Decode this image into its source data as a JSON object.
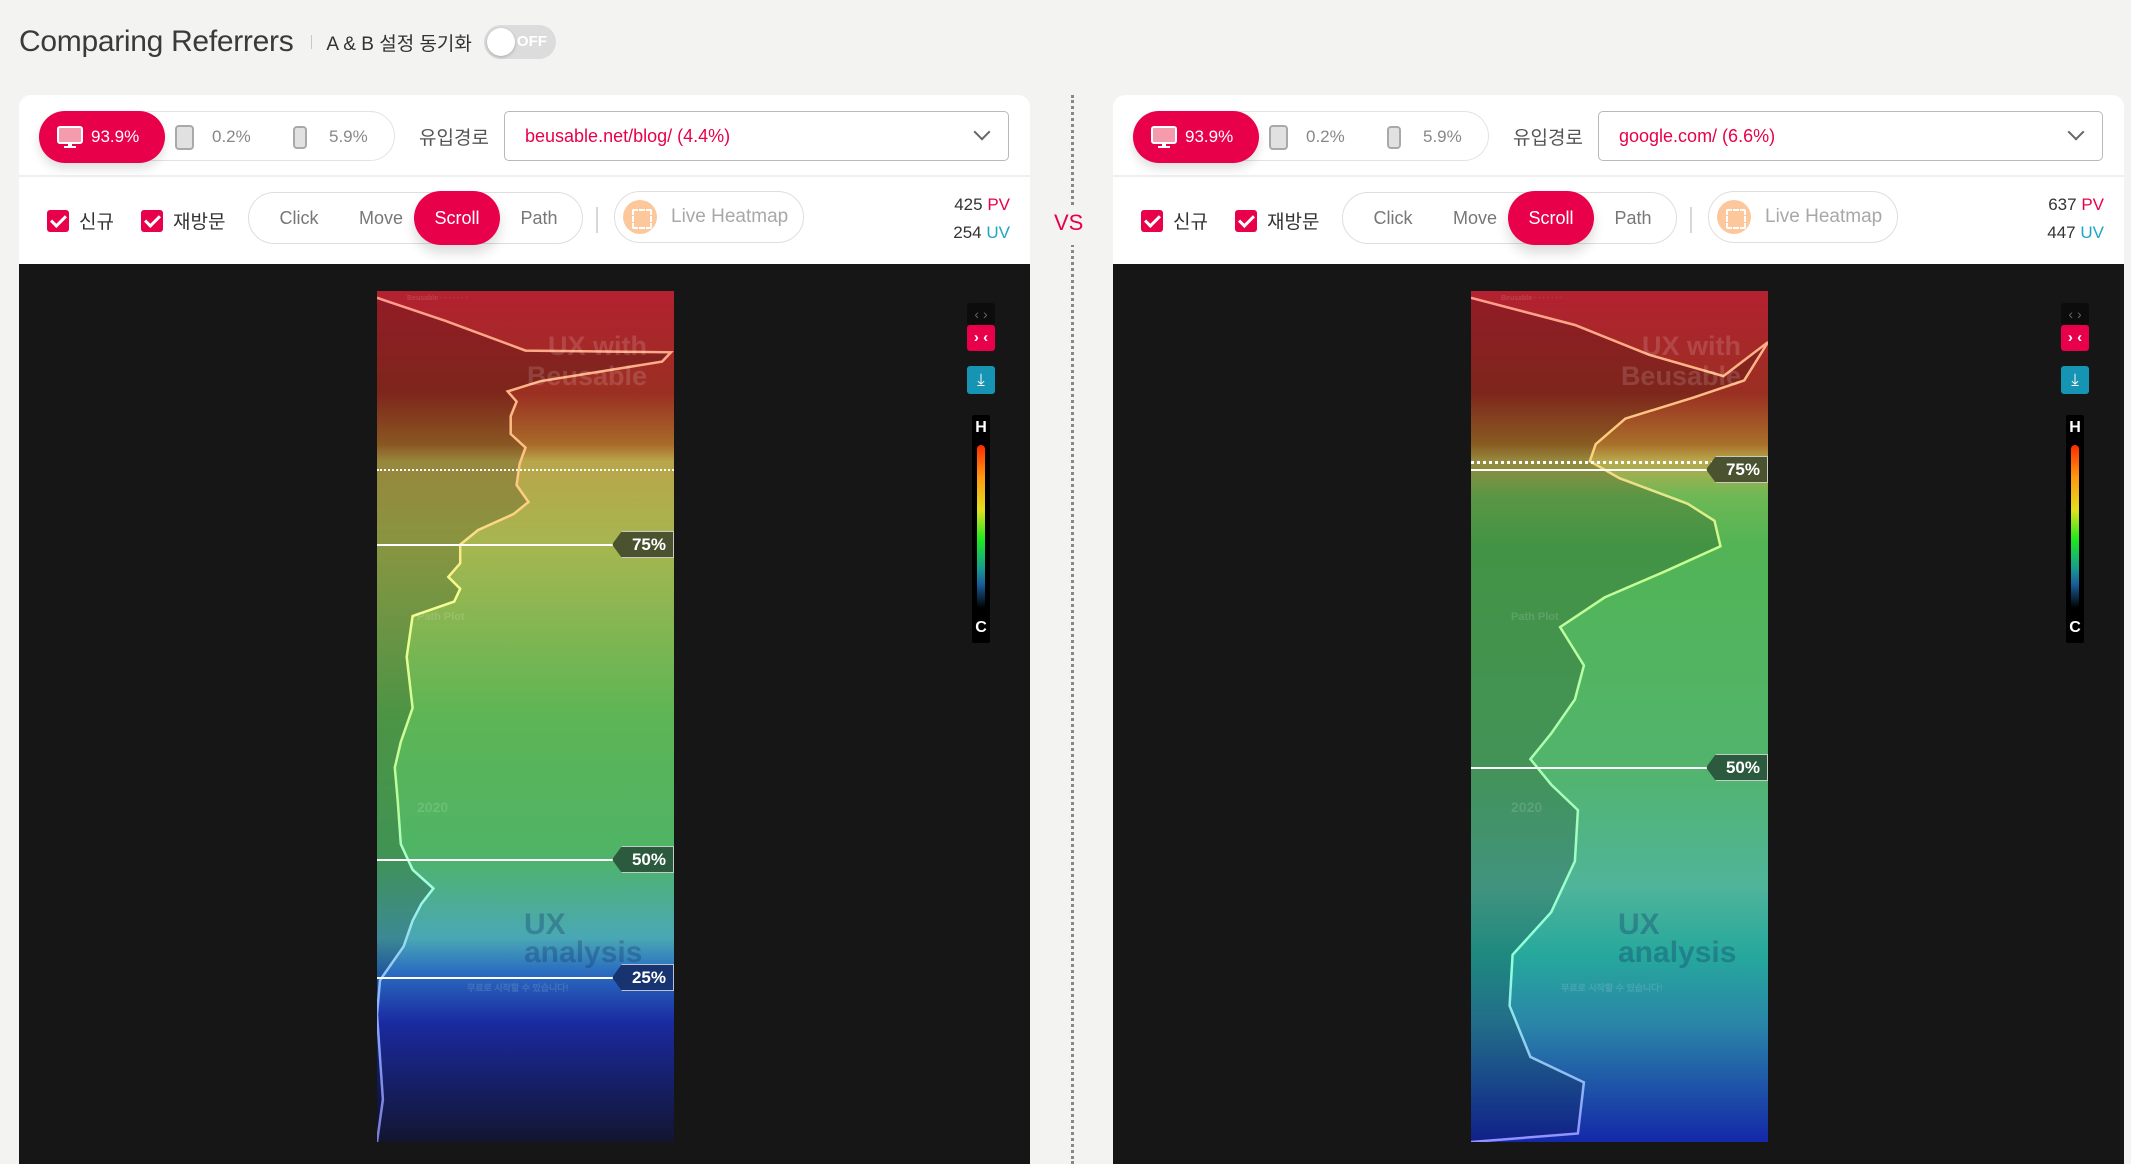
{
  "header": {
    "title": "Comparing Referrers",
    "sync_label": "A & B 설정 동기화",
    "sync_toggle": "OFF"
  },
  "vs_label": "VS",
  "panels": [
    {
      "devices": [
        {
          "name": "desktop",
          "value": "93.9%",
          "active": true
        },
        {
          "name": "tablet",
          "value": "0.2%",
          "active": false
        },
        {
          "name": "mobile",
          "value": "5.9%",
          "active": false
        }
      ],
      "referrer_label": "유입경로",
      "referrer_value": "beusable.net/blog/ (4.4%)",
      "filters": {
        "new": "신규",
        "revisit": "재방문",
        "new_checked": true,
        "revisit_checked": true
      },
      "modes": [
        "Click",
        "Move",
        "Scroll",
        "Path"
      ],
      "active_mode": "Scroll",
      "live_heatmap": "Live Heatmap",
      "pv": "425",
      "pv_unit": "PV",
      "uv": "254",
      "uv_unit": "UV",
      "markers": [
        {
          "label": "75%",
          "pos": 0.298
        },
        {
          "label": "50%",
          "pos": 0.668
        },
        {
          "label": "25%",
          "pos": 0.806
        }
      ],
      "fold_line": 0.209,
      "legend": {
        "hot": "H",
        "cold": "C"
      }
    },
    {
      "devices": [
        {
          "name": "desktop",
          "value": "93.9%",
          "active": true
        },
        {
          "name": "tablet",
          "value": "0.2%",
          "active": false
        },
        {
          "name": "mobile",
          "value": "5.9%",
          "active": false
        }
      ],
      "referrer_label": "유입경로",
      "referrer_value": "google.com/ (6.6%)",
      "filters": {
        "new": "신규",
        "revisit": "재방문",
        "new_checked": true,
        "revisit_checked": true
      },
      "modes": [
        "Click",
        "Move",
        "Scroll",
        "Path"
      ],
      "active_mode": "Scroll",
      "live_heatmap": "Live Heatmap",
      "pv": "637",
      "pv_unit": "PV",
      "uv": "447",
      "uv_unit": "UV",
      "markers": [
        {
          "label": "75%",
          "pos": 0.209
        },
        {
          "label": "50%",
          "pos": 0.559
        }
      ],
      "fold_line": 0.2,
      "legend": {
        "hot": "H",
        "cold": "C"
      }
    }
  ],
  "heatmap_page_text": {
    "hero": "UX with Beusable",
    "section": "Path Plot",
    "year": "2020",
    "analysis": "UX analysis",
    "cta": "무료로 시작할 수 있습니다!"
  },
  "colors": {
    "accent": "#e8004a",
    "uv": "#1ea6c2",
    "download": "#1594b3"
  }
}
